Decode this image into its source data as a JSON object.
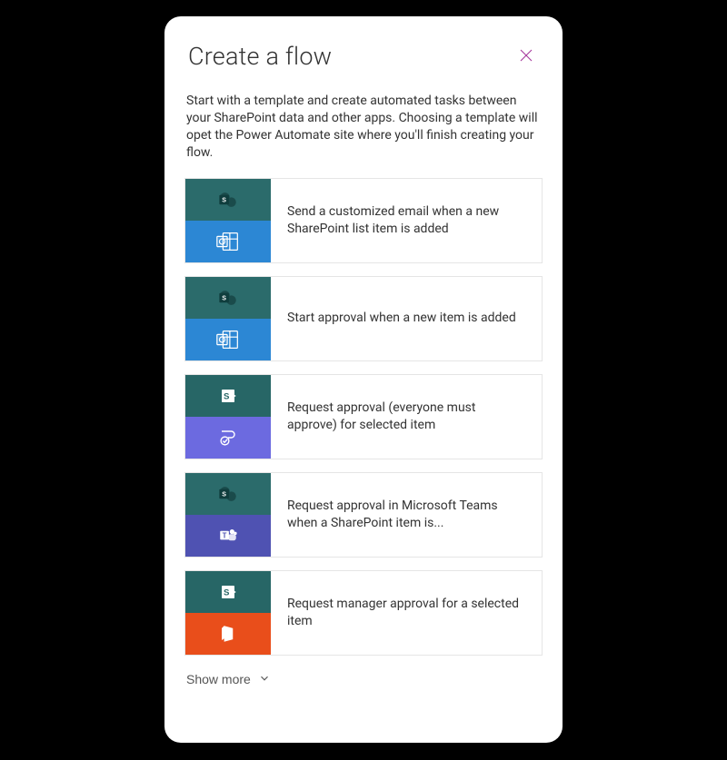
{
  "panel": {
    "title": "Create a flow",
    "description": "Start with a template and create automated tasks between your SharePoint data and other apps. Choosing a template will opet the Power Automate site where you'll finish creating your flow.",
    "show_more_label": "Show more"
  },
  "templates": [
    {
      "label": "Send a customized email when a new SharePoint list item is added",
      "top_icon": "sharepoint-green",
      "bottom_icon": "outlook"
    },
    {
      "label": "Start approval when a new item is added",
      "top_icon": "sharepoint-green",
      "bottom_icon": "outlook"
    },
    {
      "label": "Request approval (everyone must approve) for selected item",
      "top_icon": "sharepoint-teal",
      "bottom_icon": "approval-purple"
    },
    {
      "label": "Request approval in Microsoft Teams when a SharePoint item is...",
      "top_icon": "sharepoint-green",
      "bottom_icon": "teams"
    },
    {
      "label": "Request manager approval for a selected item",
      "top_icon": "sharepoint-teal",
      "bottom_icon": "office"
    }
  ],
  "colors": {
    "accent_close": "#a83d9e",
    "border": "#e5e5e5"
  }
}
